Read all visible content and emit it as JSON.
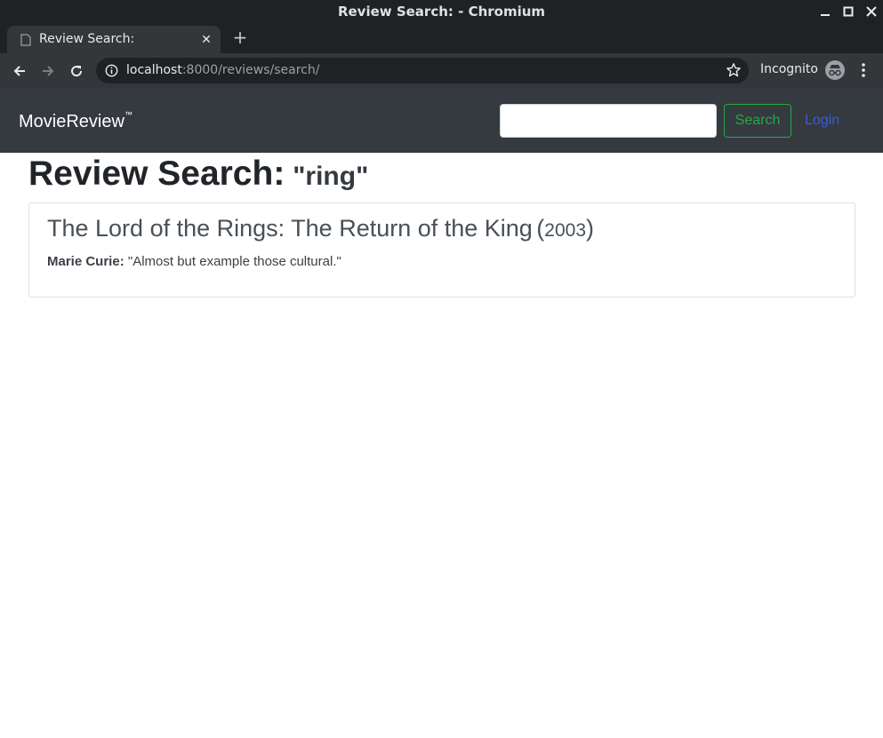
{
  "window": {
    "title": "Review Search: - Chromium"
  },
  "tab": {
    "title": "Review Search:"
  },
  "address_bar": {
    "host": "localhost",
    "path": ":8000/reviews/search/"
  },
  "incognito": {
    "label": "Incognito"
  },
  "navbar": {
    "brand": "MovieReview",
    "brand_mark": "™",
    "search_value": "",
    "search_button": "Search",
    "login_link": "Login"
  },
  "page": {
    "heading": "Review Search:",
    "query": "\"ring\""
  },
  "results": [
    {
      "title": "The Lord of the Rings: The Return of the King",
      "year": "2003",
      "reviewer": "Marie Curie:",
      "quote": "\"Almost but example those cultural.\""
    }
  ],
  "colors": {
    "navbar_bg": "#343a40",
    "search_button": "#28a745",
    "login_link": "#3b5bdb"
  }
}
